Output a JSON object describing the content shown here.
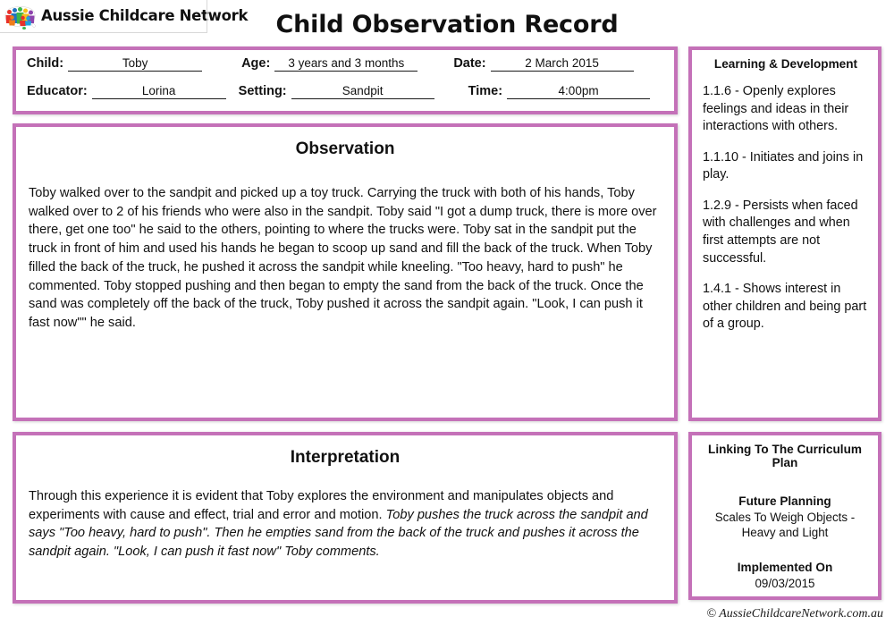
{
  "brand": {
    "logo_text": "Aussie Childcare Network",
    "logo_icon": "australia-map-children-icon"
  },
  "header": {
    "title": "Child Observation Record"
  },
  "info": {
    "fields": [
      {
        "label": "Child:",
        "value": "Toby"
      },
      {
        "label": "Age:",
        "value": "3 years and 3 months"
      },
      {
        "label": "Date:",
        "value": "2 March 2015"
      },
      {
        "label": "Educator:",
        "value": "Lorina"
      },
      {
        "label": "Setting:",
        "value": "Sandpit"
      },
      {
        "label": "Time:",
        "value": "4:00pm"
      }
    ]
  },
  "observation": {
    "title": "Observation",
    "text": "Toby walked over to the sandpit and picked up a toy truck. Carrying the truck with both of his hands, Toby walked over to 2 of his friends who were also in the sandpit. Toby said \"I got a dump truck, there is more over there, get one too\" he said to the others, pointing to where the trucks were. Toby sat in the sandpit put the truck in front of him and used his hands he began to scoop up sand and fill the back of the truck. When Toby filled the back of the truck, he pushed it across the sandpit while kneeling. \"Too heavy, hard to push\" he commented. Toby stopped pushing and then began to empty the sand from the back of the truck. Once the sand was completely off the back of the truck, Toby pushed it across the sandpit again. \"Look, I can push it fast now\"\" he said."
  },
  "interpretation": {
    "title": "Interpretation",
    "text_plain": "Through this experience it is evident that Toby explores the environment and manipulates objects and experiments with cause and effect, trial and error and motion. ",
    "text_italic": "Toby pushes the truck across the sandpit and says \"Too heavy, hard to push\". Then he empties sand from the back of the truck and pushes it across the sandpit again. \"Look, I can push it fast now\" Toby comments."
  },
  "learning": {
    "title": "Learning & Development",
    "outcomes": [
      "1.1.6 - Openly explores feelings and ideas in their interactions with others.",
      "1.1.10 - Initiates and joins in play.",
      "1.2.9 - Persists when faced with challenges and when first attempts are not successful.",
      "1.4.1 - Shows interest in other children and being part of a group."
    ]
  },
  "curriculum": {
    "title": "Linking To The Curriculum Plan",
    "future_planning_label": "Future Planning",
    "future_planning_value": "Scales To Weigh Objects - Heavy and Light",
    "implemented_label": "Implemented On",
    "implemented_value": "09/03/2015"
  },
  "footer": {
    "copyright": "© AussieChildcareNetwork.com.au"
  },
  "theme": {
    "border_color": "#c471b8",
    "text_color": "#111111",
    "background": "#ffffff"
  }
}
